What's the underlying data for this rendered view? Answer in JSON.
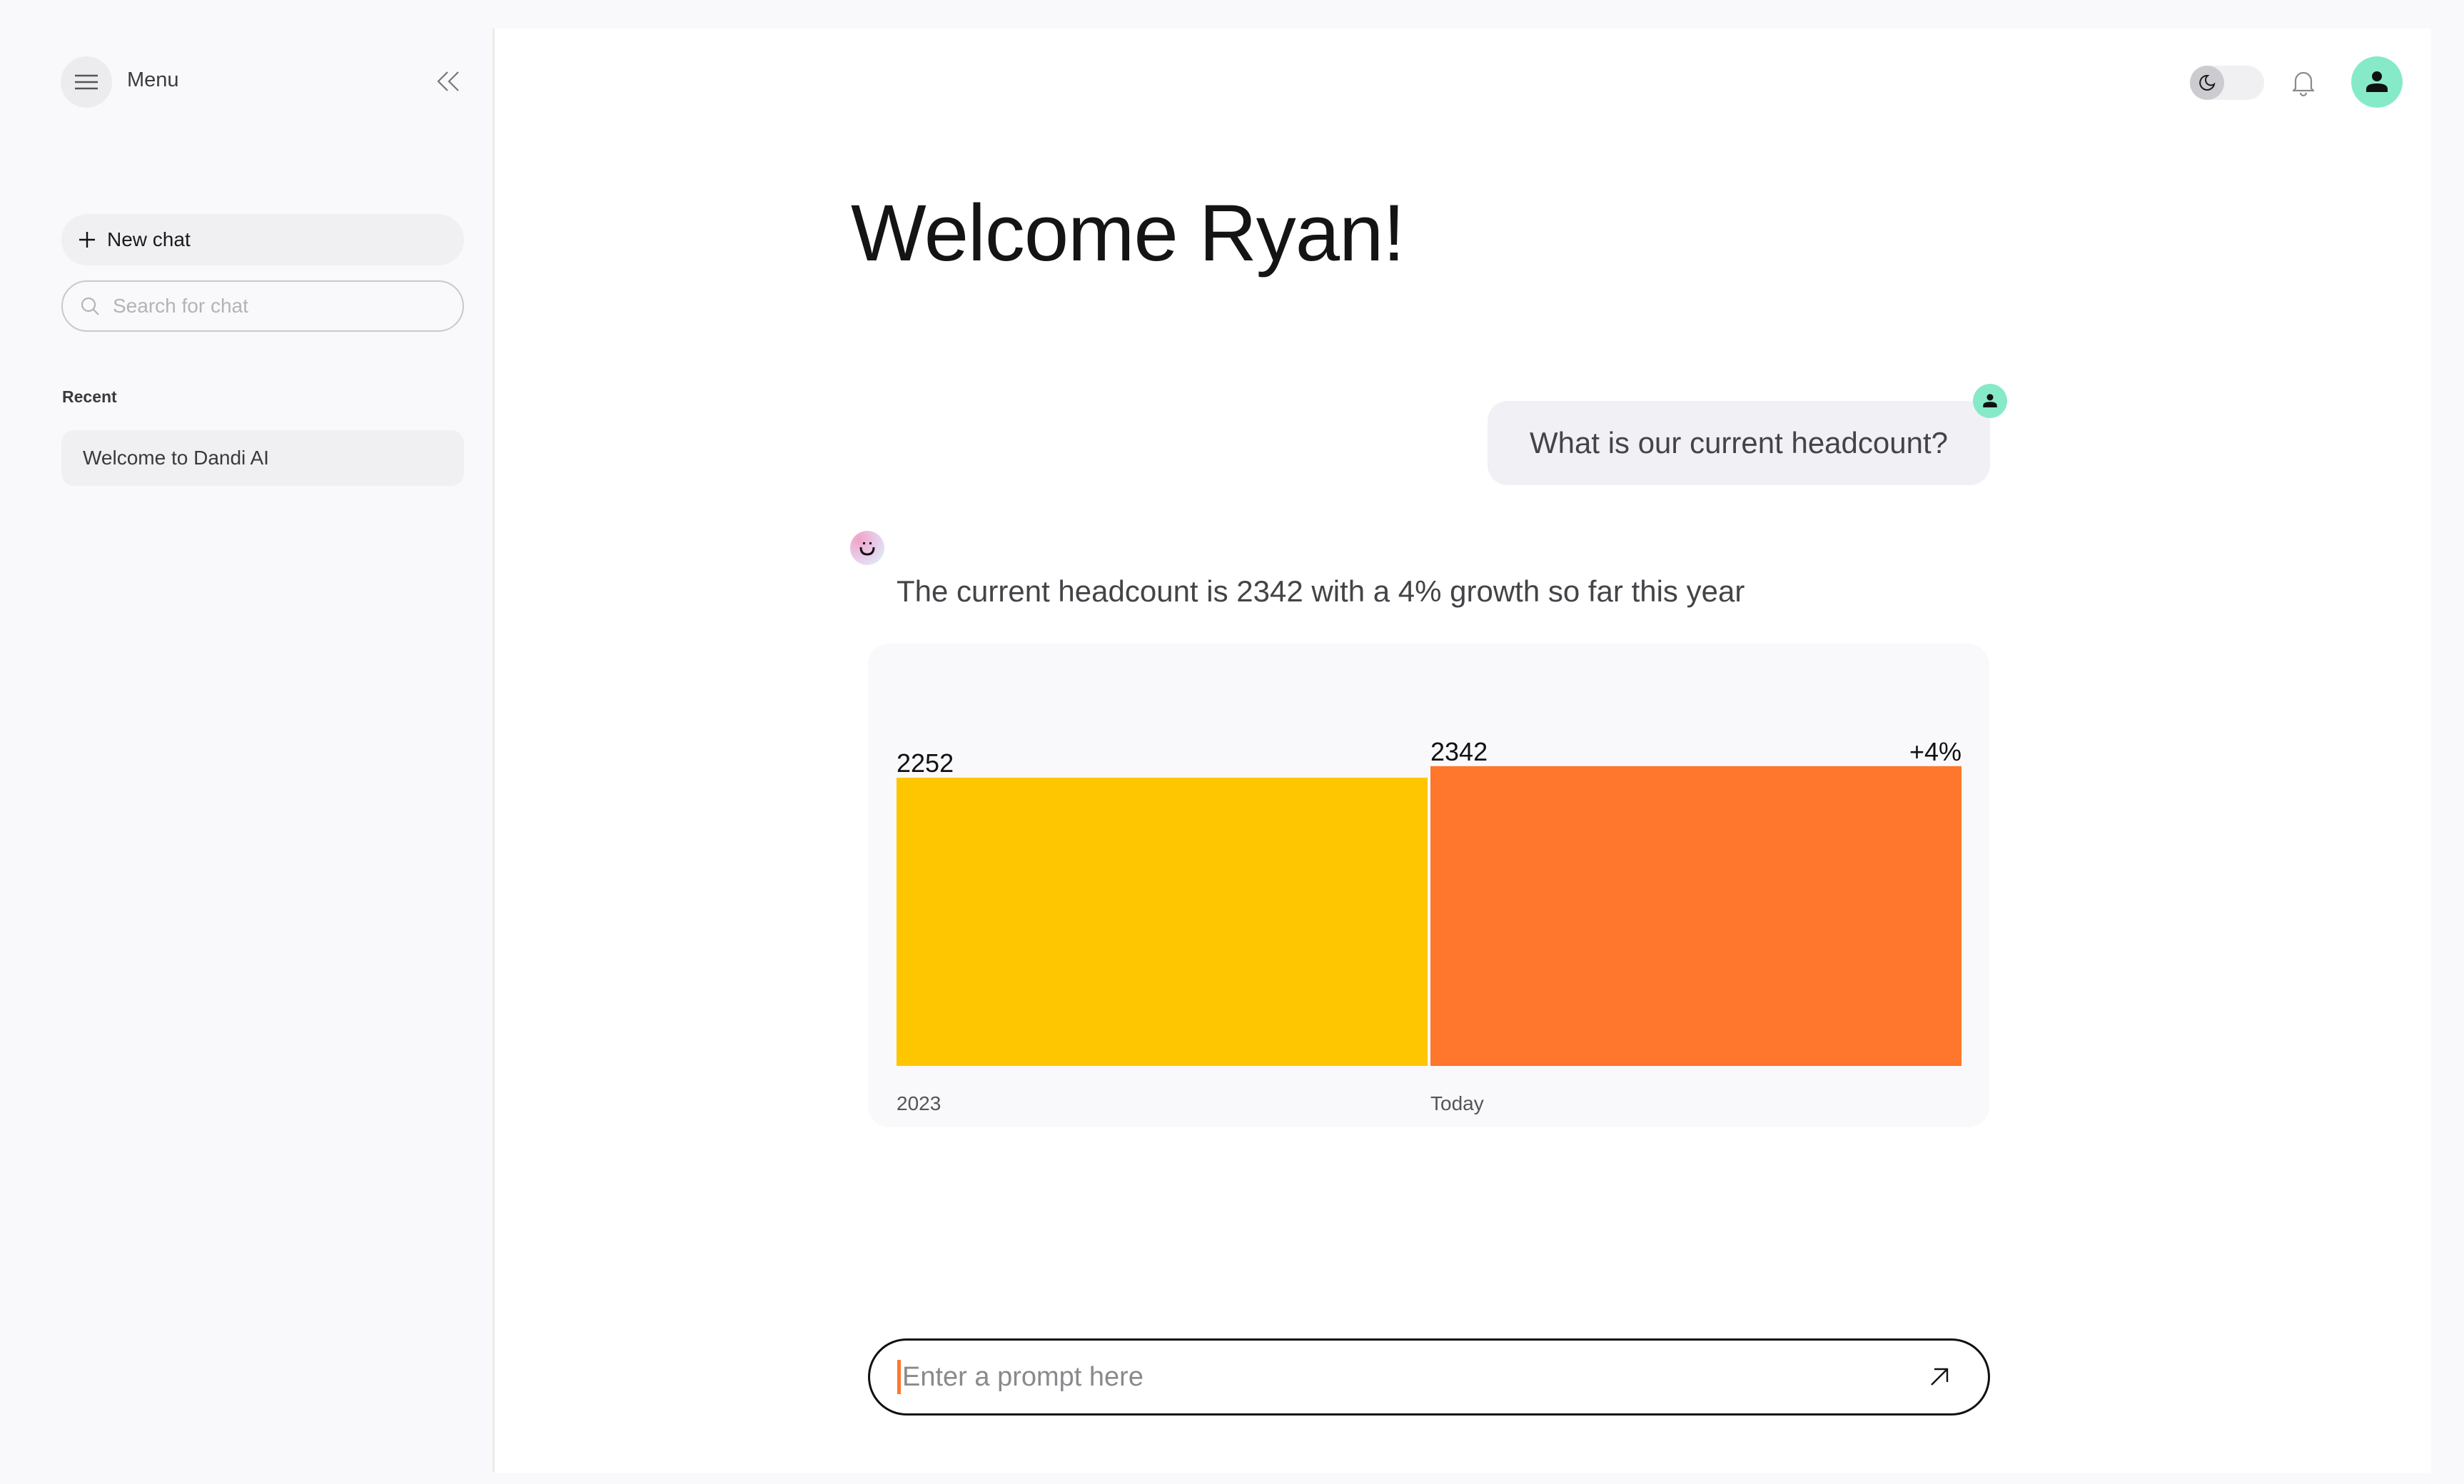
{
  "sidebar": {
    "menu_label": "Menu",
    "new_chat_label": "New chat",
    "search_placeholder": "Search for chat",
    "search_value": "",
    "recent_heading": "Recent",
    "recent_items": [
      {
        "label": "Welcome to Dandi AI"
      }
    ]
  },
  "header": {
    "theme_toggle": "dark-mode",
    "avatar_color": "#86eac8"
  },
  "main": {
    "title": "Welcome Ryan!",
    "messages": [
      {
        "role": "user",
        "text": "What is our current headcount?"
      },
      {
        "role": "assistant",
        "text": "The current headcount is 2342 with a 4% growth so far this year"
      }
    ],
    "prompt_placeholder": "Enter a prompt here",
    "prompt_value": ""
  },
  "colors": {
    "accent": "#ff762d",
    "bar_2023": "#fec600",
    "bar_today": "#ff762d",
    "avatar": "#86eac8"
  },
  "chart_data": {
    "type": "bar",
    "title": "",
    "xlabel": "",
    "ylabel": "",
    "categories": [
      "2023",
      "Today"
    ],
    "values": [
      2252,
      2342
    ],
    "data_labels": [
      "2252",
      "2342"
    ],
    "annotation": "+4%",
    "colors": [
      "#fec600",
      "#ff762d"
    ],
    "ylim": [
      0,
      3300
    ],
    "grid": false,
    "legend": "none"
  }
}
